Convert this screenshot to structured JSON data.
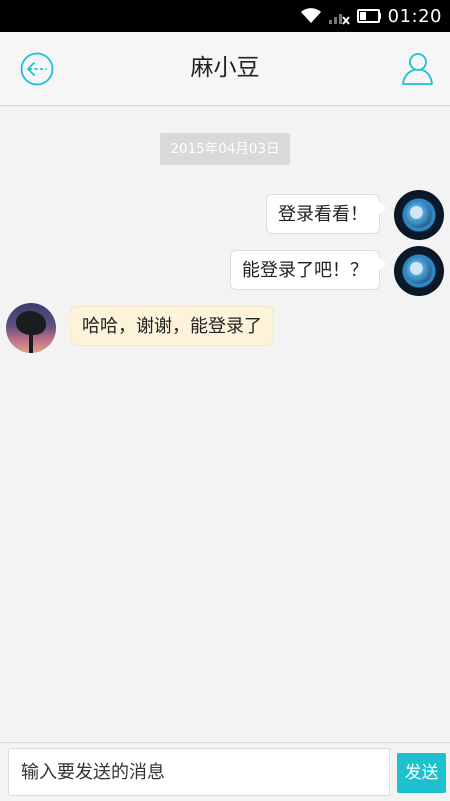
{
  "status_bar": {
    "time": "01:20",
    "icons": [
      "wifi-icon",
      "signal-icon",
      "battery-icon"
    ]
  },
  "header": {
    "title": "麻小豆",
    "back_icon": "back-arrow-icon",
    "profile_icon": "user-profile-icon"
  },
  "conversation": {
    "date": "2015年04月03日",
    "messages": [
      {
        "direction": "outgoing",
        "text": "登录看看！"
      },
      {
        "direction": "outgoing",
        "text": "能登录了吧！？"
      },
      {
        "direction": "incoming",
        "text": "哈哈，谢谢，能登录了"
      }
    ]
  },
  "composer": {
    "placeholder": "输入要发送的消息",
    "send_label": "发送"
  },
  "colors": {
    "accent": "#1ec0cf",
    "incoming_bubble": "#fdf3da",
    "outgoing_bubble": "#ffffff",
    "background": "#f3f3f3"
  }
}
